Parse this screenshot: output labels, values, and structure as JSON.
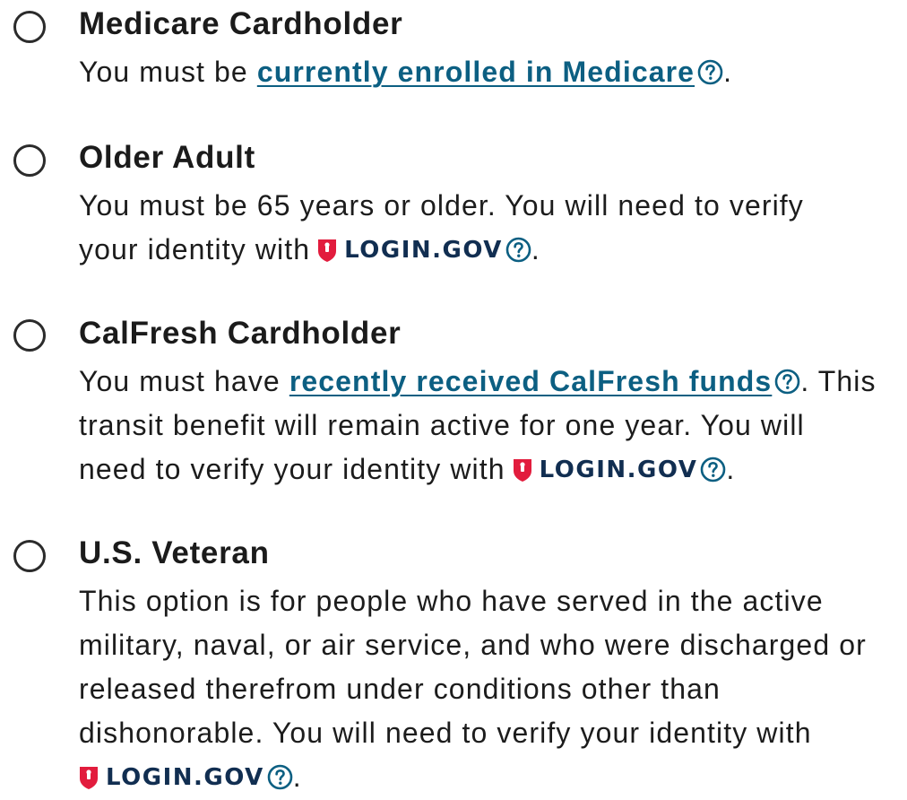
{
  "colors": {
    "link": "#0c5f82",
    "text": "#1c1c1c",
    "logingov_red": "#e21c3d",
    "logingov_navy": "#112e51"
  },
  "options": [
    {
      "title": "Medicare Cardholder",
      "desc_before": "You must be ",
      "link": "currently enrolled in Medicare",
      "desc_after": "."
    },
    {
      "title": "Older Adult",
      "line1": "You must be 65 years or older. You will need to verify",
      "line2": "your identity with",
      "logingov": "LOGIN.GOV",
      "end": "."
    },
    {
      "title": "CalFresh Cardholder",
      "desc_before": "You must have ",
      "link": "recently received CalFresh funds",
      "desc_after": ". This",
      "line2": "transit benefit will remain active for one year. You will",
      "line3": "need to verify your identity with",
      "logingov": "LOGIN.GOV",
      "end": "."
    },
    {
      "title": "U.S. Veteran",
      "line1": "This option is for people who have served in the active",
      "line2": "military, naval, or air service, and who were discharged or",
      "line3": "released therefrom under conditions other than",
      "line4": "dishonorable. You will need to verify your identity with",
      "logingov": "LOGIN.GOV",
      "end": "."
    }
  ]
}
